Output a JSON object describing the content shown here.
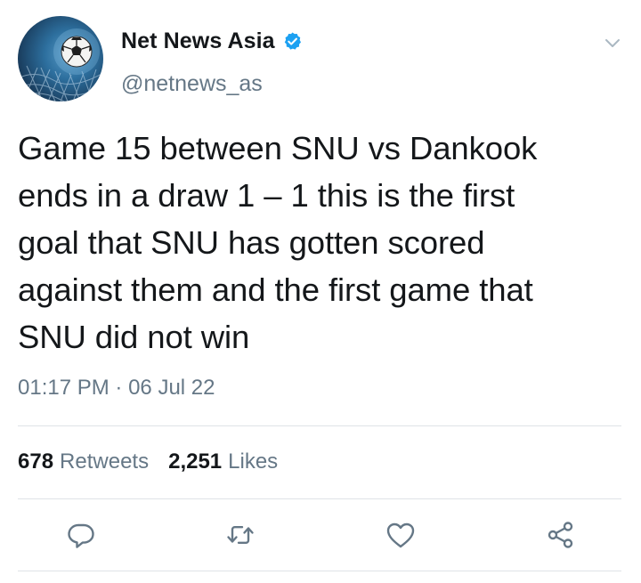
{
  "author": {
    "display_name": "Net News Asia",
    "handle": "@netnews_as",
    "verified": true,
    "avatar_icon": "soccer-ball-net-avatar"
  },
  "tweet": {
    "text": "Game 15 between SNU vs Dankook\nends in a draw 1 – 1 this is the first\ngoal that SNU has gotten scored\nagainst them and the first game that\nSNU did not win",
    "time": "01:17 PM",
    "separator": "·",
    "date": "06 Jul 22"
  },
  "stats": {
    "retweets_count": "678",
    "retweets_label": "Retweets",
    "likes_count": "2,251",
    "likes_label": "Likes"
  },
  "actions": [
    {
      "icon": "reply-icon"
    },
    {
      "icon": "retweet-icon"
    },
    {
      "icon": "like-icon"
    },
    {
      "icon": "share-icon"
    }
  ],
  "colors": {
    "text": "#14171a",
    "secondary": "#657786",
    "verified": "#1da1f2",
    "icon": "#657786",
    "divider": "#dfe3e7"
  }
}
